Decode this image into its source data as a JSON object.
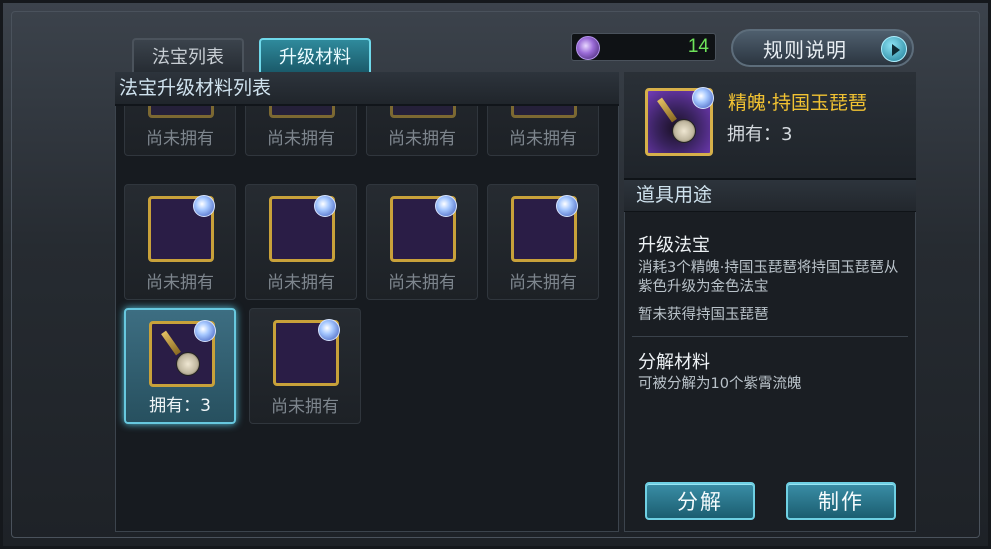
{
  "tabs": [
    {
      "label": "法宝列表",
      "active": false
    },
    {
      "label": "升级材料",
      "active": true
    }
  ],
  "currency": {
    "icon": "purple-orb-icon",
    "value": "14"
  },
  "rules_button": {
    "label": "规则说明"
  },
  "list_header": "法宝升级材料列表",
  "materials": [
    {
      "art": "top1",
      "label": "尚未拥有",
      "owned": false
    },
    {
      "art": "top2",
      "label": "尚未拥有",
      "owned": false
    },
    {
      "art": "top3",
      "label": "尚未拥有",
      "owned": false
    },
    {
      "art": "top4",
      "label": "尚未拥有",
      "owned": false
    },
    {
      "art": "green",
      "label": "尚未拥有",
      "owned": false
    },
    {
      "art": "sword",
      "label": "尚未拥有",
      "owned": false
    },
    {
      "art": "blade",
      "label": "尚未拥有",
      "owned": false
    },
    {
      "art": "purple",
      "label": "尚未拥有",
      "owned": false
    },
    {
      "art": "pipa",
      "label": "拥有：3",
      "owned": true,
      "selected": true
    },
    {
      "art": "dragon",
      "label": "尚未拥有",
      "owned": false
    }
  ],
  "detail": {
    "name": "精魄·持国玉琵琶",
    "owned": "拥有：3",
    "usage_header": "道具用途",
    "upgrade_title": "升级法宝",
    "upgrade_desc": "消耗3个精魄·持国玉琵琶将持国玉琵琶从紫色升级为金色法宝",
    "upgrade_status": "暂未获得持国玉琵琶",
    "decompose_title": "分解材料",
    "decompose_desc": "可被分解为10个紫霄流魄"
  },
  "buttons": {
    "decompose": "分解",
    "craft": "制作"
  },
  "colors": {
    "accent": "#67c8df",
    "item_name": "#f1c232",
    "currency_value": "#6ee35a"
  }
}
